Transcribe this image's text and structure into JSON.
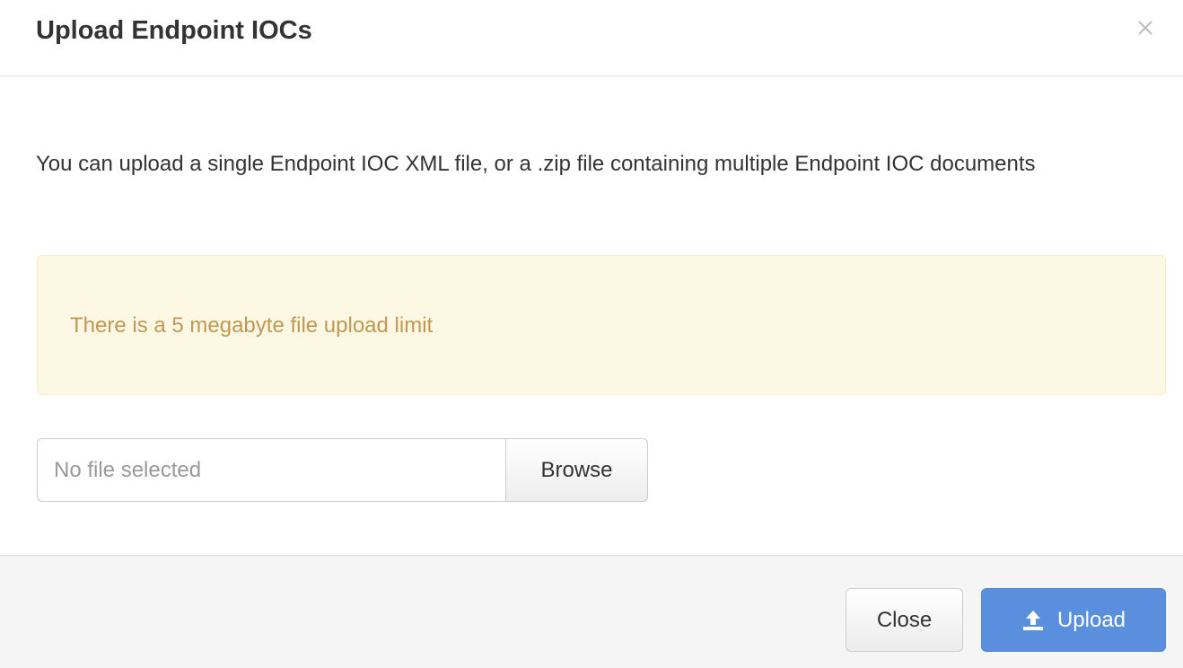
{
  "dialog": {
    "title": "Upload Endpoint IOCs",
    "close_icon": "close-icon"
  },
  "body": {
    "description": "You can upload a single Endpoint IOC XML file, or a .zip file containing multiple Endpoint IOC documents",
    "alert": {
      "text": "There is a 5 megabyte file upload limit",
      "background_color": "#fcf8e3",
      "text_color": "#c09853"
    },
    "file_input": {
      "value": "No file selected",
      "browse_label": "Browse"
    }
  },
  "footer": {
    "close_label": "Close",
    "upload_label": "Upload",
    "upload_icon": "upload-icon",
    "upload_color": "#5a8fdd"
  }
}
